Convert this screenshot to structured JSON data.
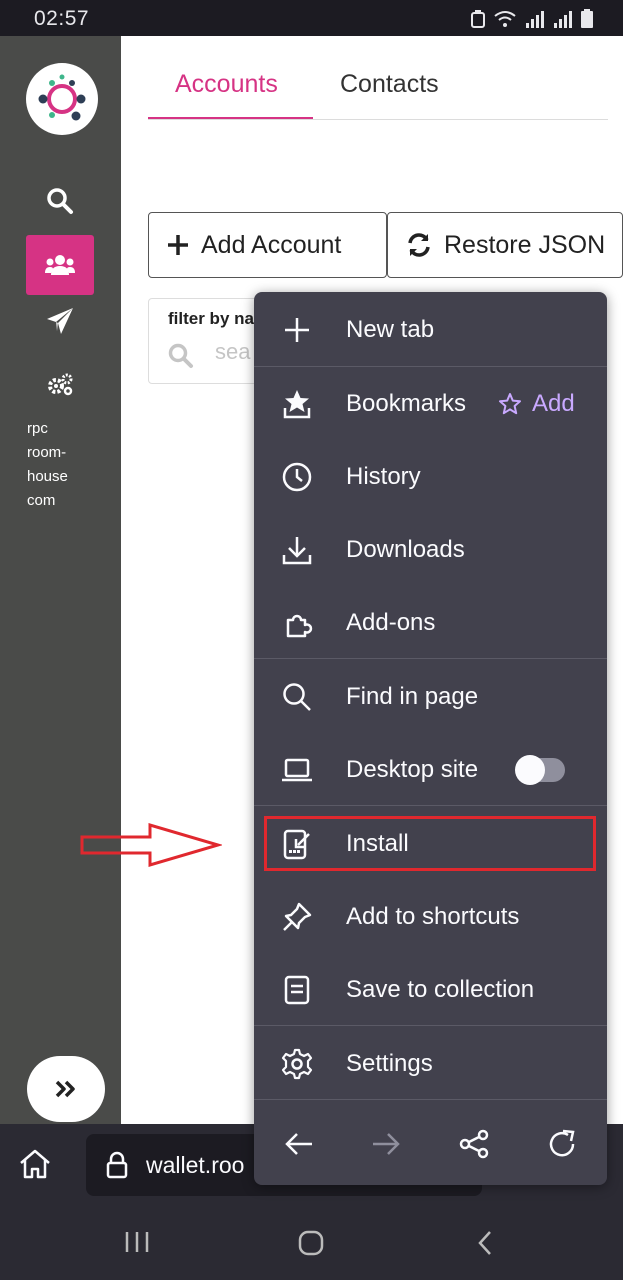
{
  "status_bar": {
    "time": "02:57"
  },
  "sidebar": {
    "rpc_lines": [
      "rpc",
      "room-",
      "house",
      "com"
    ]
  },
  "tabs": {
    "accounts": "Accounts",
    "contacts": "Contacts"
  },
  "actions": {
    "add_account": "Add Account",
    "restore_json": "Restore JSON"
  },
  "filter": {
    "label": "filter by na",
    "placeholder": "sea"
  },
  "browser": {
    "url": "wallet.roo"
  },
  "menu": {
    "new_tab": "New tab",
    "bookmarks": "Bookmarks",
    "bookmarks_add": "Add",
    "history": "History",
    "downloads": "Downloads",
    "addons": "Add-ons",
    "find_in_page": "Find in page",
    "desktop_site": "Desktop site",
    "desktop_site_enabled": false,
    "install": "Install",
    "add_to_shortcuts": "Add to shortcuts",
    "save_to_collection": "Save to collection",
    "settings": "Settings"
  },
  "colors": {
    "accent": "#d63384",
    "menu_bg": "#42414d",
    "sidebar_bg": "#4a4b49",
    "highlight": "#e0282e",
    "bookmark_add": "#c9a9ff"
  }
}
